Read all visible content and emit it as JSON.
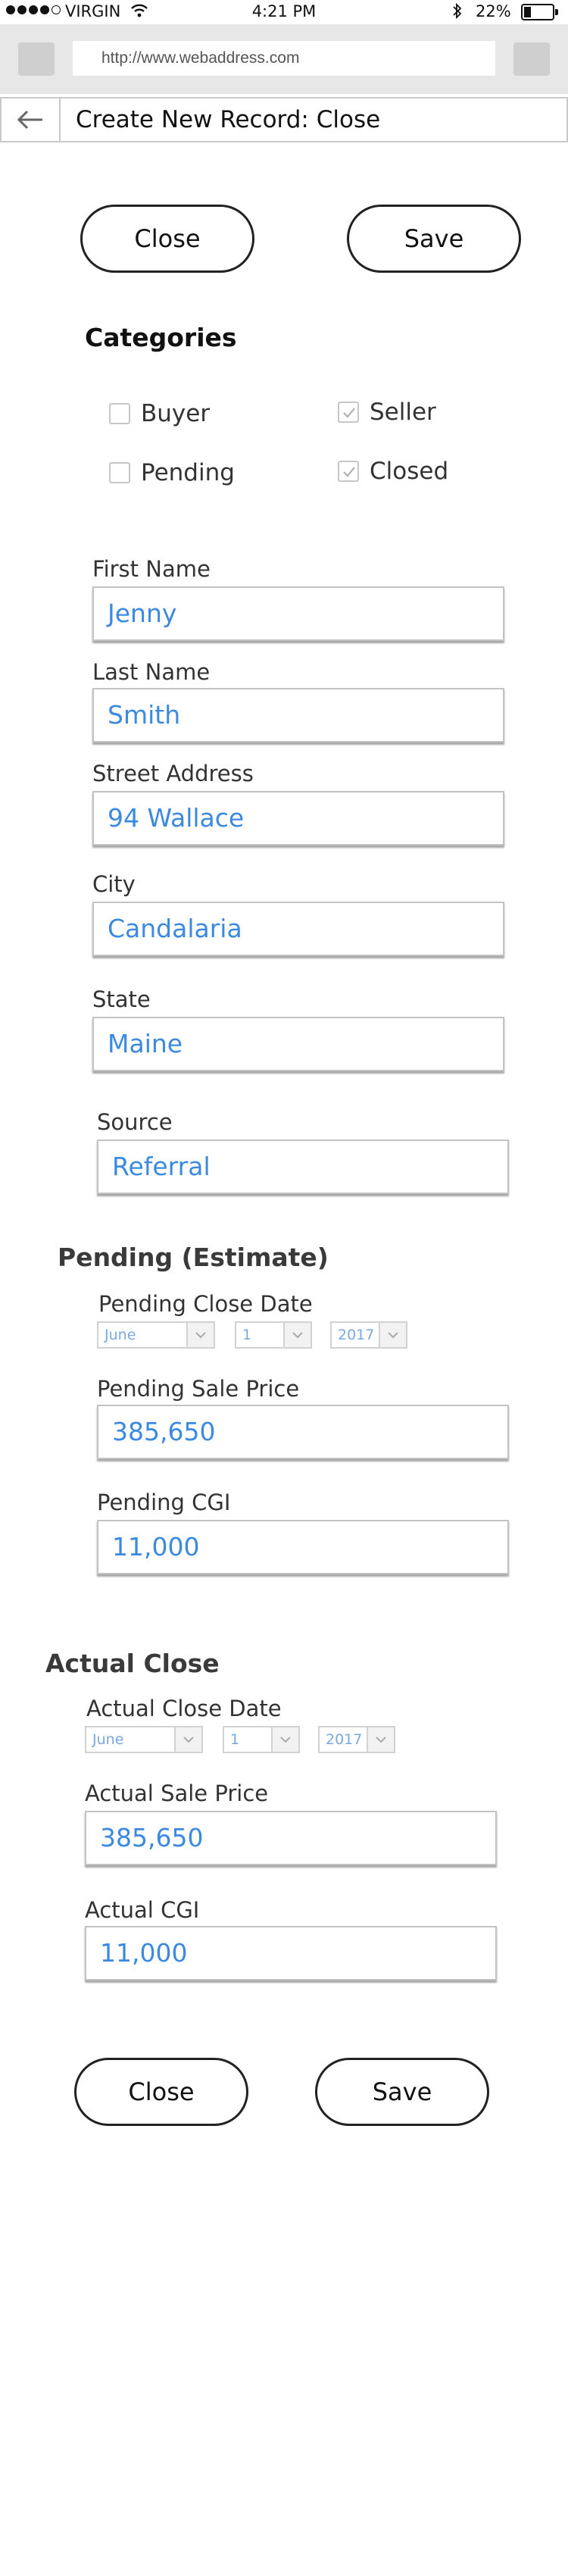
{
  "status_bar": {
    "carrier": "VIRGIN",
    "time": "4:21 PM",
    "battery": "22%",
    "battery_level": 0.22
  },
  "browser": {
    "url": "http://www.webaddress.com"
  },
  "header": {
    "title": "Create New Record: Close"
  },
  "top_actions": {
    "close_label": "Close",
    "save_label": "Save"
  },
  "categories": {
    "heading": "Categories",
    "items": [
      {
        "label": "Buyer",
        "checked": false
      },
      {
        "label": "Seller",
        "checked": true
      },
      {
        "label": "Pending",
        "checked": false
      },
      {
        "label": "Closed",
        "checked": true
      }
    ]
  },
  "contact": {
    "first_name": {
      "label": "First Name",
      "value": "Jenny"
    },
    "last_name": {
      "label": "Last Name",
      "value": "Smith"
    },
    "street": {
      "label": "Street Address",
      "value": "94 Wallace"
    },
    "city": {
      "label": "City",
      "value": "Candalaria"
    },
    "state": {
      "label": "State",
      "value": "Maine"
    },
    "source": {
      "label": "Source",
      "value": "Referral"
    }
  },
  "pending": {
    "heading": "Pending (Estimate)",
    "close_date": {
      "label": "Pending Close Date",
      "month": "June",
      "day": "1",
      "year": "2017"
    },
    "sale_price": {
      "label": "Pending Sale Price",
      "value": "385,650"
    },
    "cgi": {
      "label": "Pending CGI",
      "value": "11,000"
    }
  },
  "actual": {
    "heading": "Actual Close",
    "close_date": {
      "label": "Actual Close Date",
      "month": "June",
      "day": "1",
      "year": "2017"
    },
    "sale_price": {
      "label": "Actual Sale Price",
      "value": "385,650"
    },
    "cgi": {
      "label": "Actual CGI",
      "value": "11,000"
    }
  },
  "bottom_actions": {
    "close_label": "Close",
    "save_label": "Save"
  },
  "colors": {
    "field_text": "#3b8ae0",
    "border": "#c3c3c3",
    "browser_bar": "#e7e7e7"
  },
  "icons": {
    "wifi": "wifi-icon",
    "bluetooth": "bluetooth-icon",
    "back": "back-arrow-icon",
    "check": "check-icon",
    "dropdown": "chevron-down-icon"
  }
}
